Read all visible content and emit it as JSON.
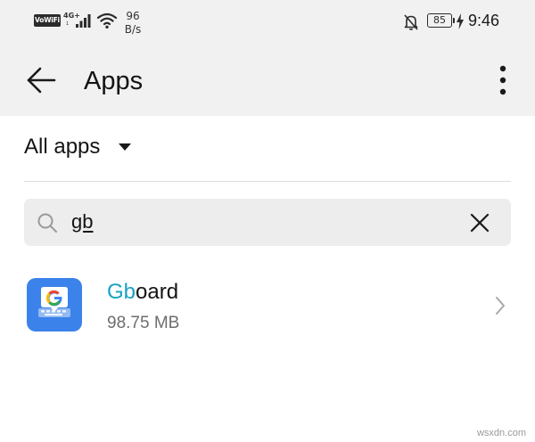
{
  "status_bar": {
    "vowifi_label": "VoWiFi",
    "network_type": "4G+",
    "network_sub": "1",
    "speed_value": "96",
    "speed_unit": "B/s",
    "battery_level": "85",
    "time": "9:46",
    "icons": [
      "signal-icon",
      "wifi-icon",
      "bell-off-icon",
      "battery-icon",
      "bolt-icon"
    ]
  },
  "app_bar": {
    "title": "Apps",
    "back_icon": "arrow-left-icon",
    "more_icon": "more-vertical-icon"
  },
  "filter": {
    "label": "All apps",
    "icon": "caret-down-icon"
  },
  "search": {
    "query": "gb",
    "icon": "search-icon",
    "clear_icon": "close-icon"
  },
  "app_list": [
    {
      "name_highlight": "Gb",
      "name_rest": "oard",
      "size": "98.75 MB",
      "icon": "gboard-icon"
    }
  ],
  "watermark": "wsxdn.com",
  "colors": {
    "top_background": "#f1f1f1",
    "highlight": "#17a2c4",
    "gboard_blue": "#3b82ea",
    "secondary_text": "#6e6e6e"
  }
}
